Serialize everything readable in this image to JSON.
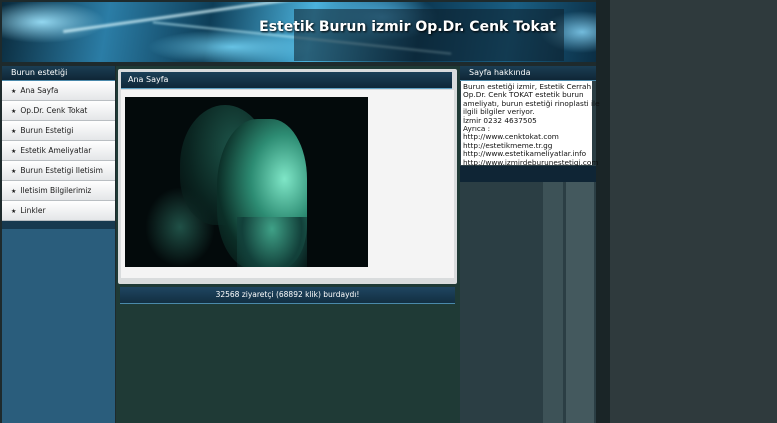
{
  "header": {
    "title": "Estetik Burun izmir Op.Dr. Cenk Tokat"
  },
  "left_sidebar": {
    "title": "Burun estetiği",
    "items": [
      {
        "label": "Ana Sayfa"
      },
      {
        "label": "Op.Dr. Cenk Tokat"
      },
      {
        "label": "Burun Estetigi"
      },
      {
        "label": "Estetik Ameliyatlar"
      },
      {
        "label": "Burun Estetigi Iletisim"
      },
      {
        "label": "Iletisim Bilgilerimiz"
      },
      {
        "label": "Linkler"
      }
    ]
  },
  "main": {
    "title": "Ana Sayfa",
    "counter": "32568 ziyaretçi (68892 klik) burdaydı!"
  },
  "right_sidebar": {
    "title": "Sayfa hakkında",
    "lines": [
      "Burun estetiği izmir, Estetik Cerrah",
      "Op.Dr. Cenk TOKAT estetik burun",
      "ameliyatı, burun estetiği rinoplasti ile",
      "ilgili bilgiler veriyor.",
      "İzmir 0232 4637505",
      "Ayrıca :",
      "http://www.cenktokat.com",
      "http://estetikmeme.tr.gg",
      "http://www.estetikameliyatlar.info",
      "http://www.izmirdeburunestetigi.com"
    ]
  },
  "colors": {
    "page_background": "#2f3a3d",
    "sidebar_blue": "#2a5d7c",
    "panel_header": "#0f2636",
    "menu_item": "#ffffff"
  },
  "icons": {
    "menu_bullet": "star-bullet-icon"
  }
}
